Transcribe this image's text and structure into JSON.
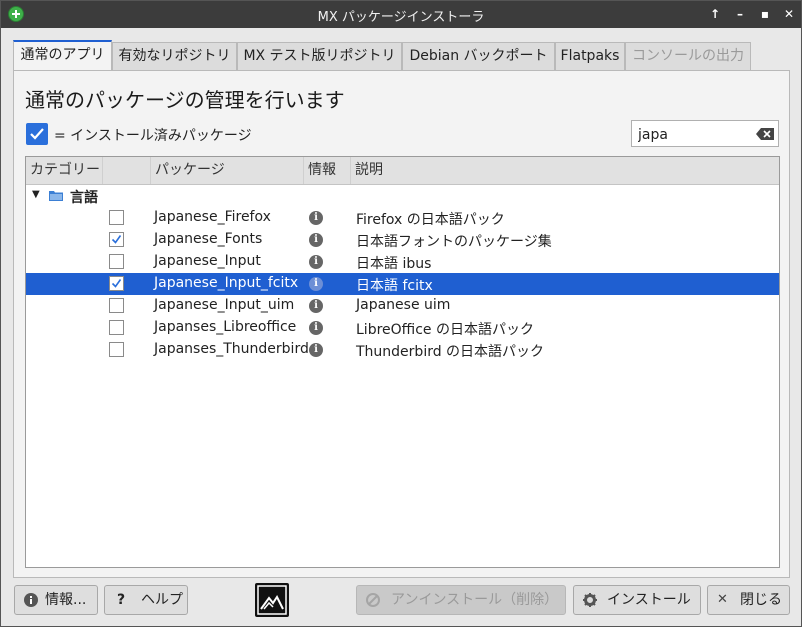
{
  "window": {
    "title": "MX パッケージインストーラ"
  },
  "titlebar_buttons": [
    "up-arrow-icon",
    "minimize-icon",
    "maximize-icon",
    "close-icon"
  ],
  "tabs": [
    {
      "label": "通常のアプリ",
      "state": "active"
    },
    {
      "label": "有効なリポジトリ",
      "state": "normal"
    },
    {
      "label": "MX テスト版リポジトリ",
      "state": "normal"
    },
    {
      "label": "Debian バックポート",
      "state": "normal"
    },
    {
      "label": "Flatpaks",
      "state": "normal"
    },
    {
      "label": "コンソールの出力",
      "state": "disabled"
    }
  ],
  "heading": "通常のパッケージの管理を行います",
  "legend": {
    "text": "= インストール済みパッケージ"
  },
  "search": {
    "value": "japa",
    "clear_icon": "backspace-clear-icon"
  },
  "table": {
    "headers": {
      "category": "カテゴリー",
      "package": "パッケージ",
      "info": "情報",
      "description": "説明"
    },
    "group": {
      "label": "言語",
      "expanded": true
    },
    "rows": [
      {
        "checked": false,
        "selected": false,
        "package": "Japanese_Firefox",
        "description": "Firefox の日本語パック"
      },
      {
        "checked": true,
        "selected": false,
        "package": "Japanese_Fonts",
        "description": "日本語フォントのパッケージ集"
      },
      {
        "checked": false,
        "selected": false,
        "package": "Japanese_Input",
        "description": "日本語 ibus"
      },
      {
        "checked": true,
        "selected": true,
        "package": "Japanese_Input_fcitx",
        "description": "日本語 fcitx"
      },
      {
        "checked": false,
        "selected": false,
        "package": "Japanese_Input_uim",
        "description": "Japanese uim"
      },
      {
        "checked": false,
        "selected": false,
        "package": "Japanses_Libreoffice",
        "description": "LibreOffice の日本語パック"
      },
      {
        "checked": false,
        "selected": false,
        "package": "Japanses_Thunderbird",
        "description": "Thunderbird の日本語パック"
      }
    ]
  },
  "buttons": {
    "about": "情報...",
    "help": "ヘルプ",
    "uninstall": "アンインストール（削除）",
    "install": "インストール",
    "close": "閉じる"
  },
  "colors": {
    "accent": "#1f5fd1",
    "titlebar": "#3c3c3c",
    "app_icon": "#3fb04a"
  }
}
